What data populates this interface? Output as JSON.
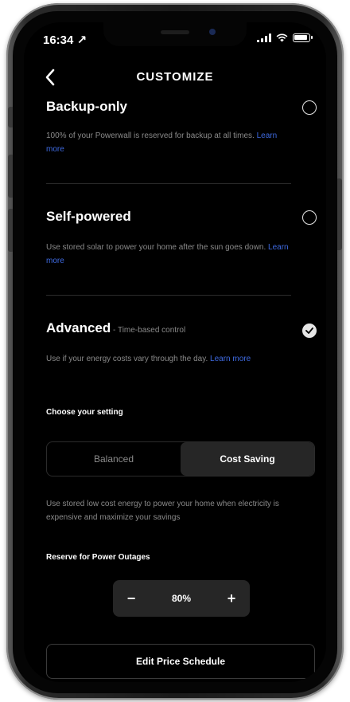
{
  "status_bar": {
    "time": "16:34 ↗"
  },
  "nav": {
    "title": "CUSTOMIZE",
    "back_icon": "chevron-left-icon"
  },
  "modes": [
    {
      "title": "Backup-only",
      "description": "100% of your Powerwall is reserved for backup at all times.",
      "learn_more": "Learn more",
      "selected": false
    },
    {
      "title": "Self-powered",
      "description": "Use stored solar to power your home after the sun goes down.",
      "learn_more": "Learn more",
      "selected": false
    },
    {
      "title": "Advanced",
      "subtitle": " - Time-based control",
      "description": "Use if your energy costs vary through the day.",
      "learn_more": "Learn more",
      "selected": true
    }
  ],
  "setting": {
    "label": "Choose your setting",
    "options": [
      "Balanced",
      "Cost Saving"
    ],
    "selected": "Cost Saving",
    "description": "Use stored low cost energy to power your home when electricity is expensive and maximize your savings"
  },
  "reserve": {
    "label": "Reserve for Power Outages",
    "minus": "−",
    "value": "80%",
    "plus": "+"
  },
  "edit_schedule_label": "Edit Price Schedule",
  "colors": {
    "background": "#000000",
    "text": "#ffffff",
    "muted": "#8a8a8a",
    "link": "#3e6ae1",
    "divider": "#2b2b2b",
    "active_segment": "#262626"
  }
}
